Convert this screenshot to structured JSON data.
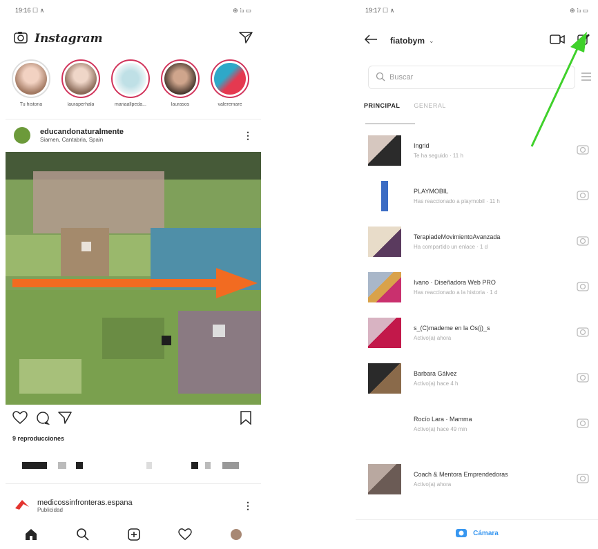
{
  "left": {
    "status_time": "19:16 ☐ ∧",
    "status_right": "⊕ ⁝ᵢₗ ▭",
    "logo": "Instagram",
    "stories": [
      {
        "name": "Tu historia"
      },
      {
        "name": "lauraperhala"
      },
      {
        "name": "mariaallpeda..."
      },
      {
        "name": "laurasos"
      },
      {
        "name": "valeremare"
      }
    ],
    "post": {
      "user": "educandonaturalmente",
      "location": "Siamen, Cantabria, Spain",
      "views": "9 reproducciones"
    },
    "ad": {
      "user": "medicossinfronteras.espana",
      "label": "Publicidad"
    }
  },
  "right": {
    "status_time": "19:17 ☐ ∧",
    "status_right": "⊕ ⁝ᵢₗ ▭",
    "username": "fiatobym",
    "search_placeholder": "Buscar",
    "tabs": {
      "principal": "PRINCIPAL",
      "general": "GENERAL"
    },
    "chats": [
      {
        "name": "Ingrid",
        "sub": "Te ha seguido · 11 h"
      },
      {
        "name": "PLAYMOBIL",
        "sub": "Has reaccionado a playmobil · 11 h"
      },
      {
        "name": "TerapiadeMovimientoAvanzada",
        "sub": "Ha compartido un enlace · 1 d"
      },
      {
        "name": "Ivano · Diseñadora Web PRO",
        "sub": "Has reaccionado a la historia · 1 d"
      },
      {
        "name": "s_(C)mademe en la Os(j)_s",
        "sub": "Activo(a) ahora"
      },
      {
        "name": "Barbara Gálvez",
        "sub": "Activo(a) hace 4 h"
      },
      {
        "name": "Rocío Lara · Mamma",
        "sub": "Activo(a) hace 49 min"
      },
      {
        "name": "Coach & Mentora Emprendedoras",
        "sub": "Activo(a) ahora"
      }
    ],
    "camera_label": "Cámara"
  },
  "colors": {
    "orange_arrow": "#f26b21",
    "green_arrow": "#3fd12b",
    "link_blue": "#3897f0"
  }
}
